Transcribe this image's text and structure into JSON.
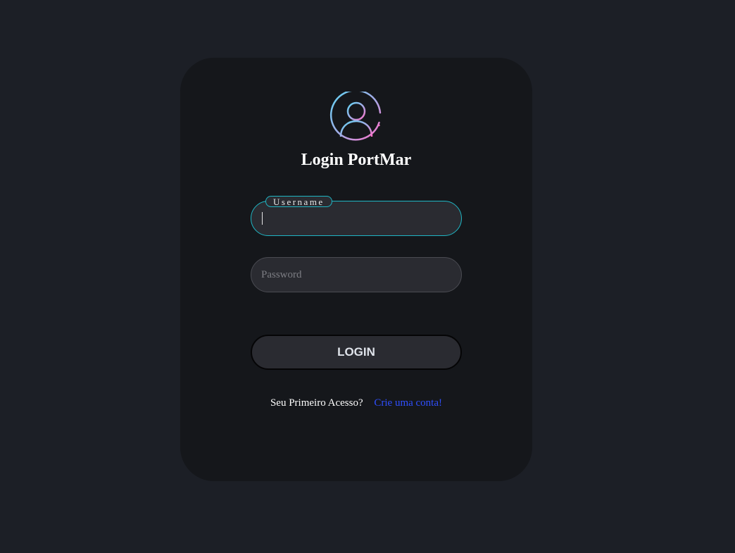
{
  "header": {
    "title": "Login PortMar",
    "avatar_icon": "user-circle-icon",
    "avatar_gradient": [
      "#5fd3f3",
      "#ff6ec7"
    ]
  },
  "form": {
    "username": {
      "label": "Username",
      "value": "",
      "focused": true
    },
    "password": {
      "placeholder": "Password",
      "value": ""
    },
    "login_label": "LOGIN"
  },
  "footer": {
    "question": "Seu Primeiro Acesso?",
    "link_label": "Crie uma conta!"
  },
  "colors": {
    "background": "#1c1f26",
    "card": "#15171b",
    "field": "#2a2b31",
    "focus_accent": "#1fb6c4",
    "link": "#2f4fff"
  }
}
